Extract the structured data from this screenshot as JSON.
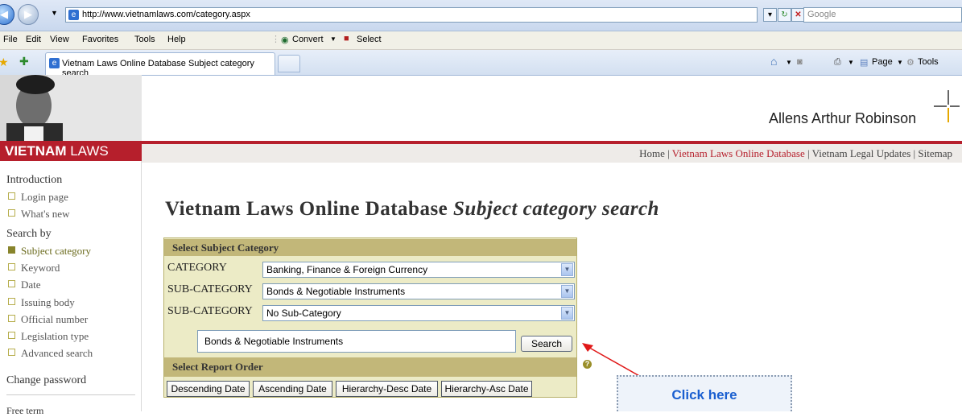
{
  "browser": {
    "url": "http://www.vietnamlaws.com/category.aspx",
    "search_placeholder": "Google",
    "menu": [
      "File",
      "Edit",
      "View",
      "Favorites",
      "Tools",
      "Help"
    ],
    "toolbar_convert": "Convert",
    "toolbar_select": "Select",
    "tab_title": "Vietnam Laws Online Database Subject category search",
    "cmd_page": "Page",
    "cmd_tools": "Tools"
  },
  "site": {
    "brand_bold": "VIETNAM",
    "brand_rest": " LAWS",
    "logo_text": "Allens Arthur Robinson",
    "topnav": {
      "home": "Home",
      "online_db": "Vietnam Laws Online Database",
      "legal_updates": "Vietnam Legal Updates",
      "sitemap": "Sitemap",
      "sep": " | "
    }
  },
  "sidebar": {
    "introduction": "Introduction",
    "intro_items": [
      "Login page",
      "What's new"
    ],
    "search_by": "Search by",
    "search_items": [
      "Subject category",
      "Keyword",
      "Date",
      "Issuing body",
      "Official number",
      "Legislation type",
      "Advanced search"
    ],
    "change_password": "Change password",
    "free_terms": "Free term"
  },
  "main": {
    "title_normal": "Vietnam Laws Online Database ",
    "title_italic": "Subject category search",
    "panel": {
      "header": "Select Subject Category",
      "category_label": "CATEGORY",
      "category_value": "Banking, Finance & Foreign Currency",
      "sub1_label": "SUB-CATEGORY",
      "sub1_value": "Bonds & Negotiable Instruments",
      "sub2_label": "SUB-CATEGORY",
      "sub2_value": "No Sub-Category",
      "search_value": "Bonds & Negotiable Instruments",
      "search_button": "Search",
      "report_header": "Select Report Order",
      "order_buttons": [
        "Descending Date",
        "Ascending Date",
        "Hierarchy-Desc Date",
        "Hierarchy-Asc Date"
      ]
    },
    "callout": "Click here"
  }
}
